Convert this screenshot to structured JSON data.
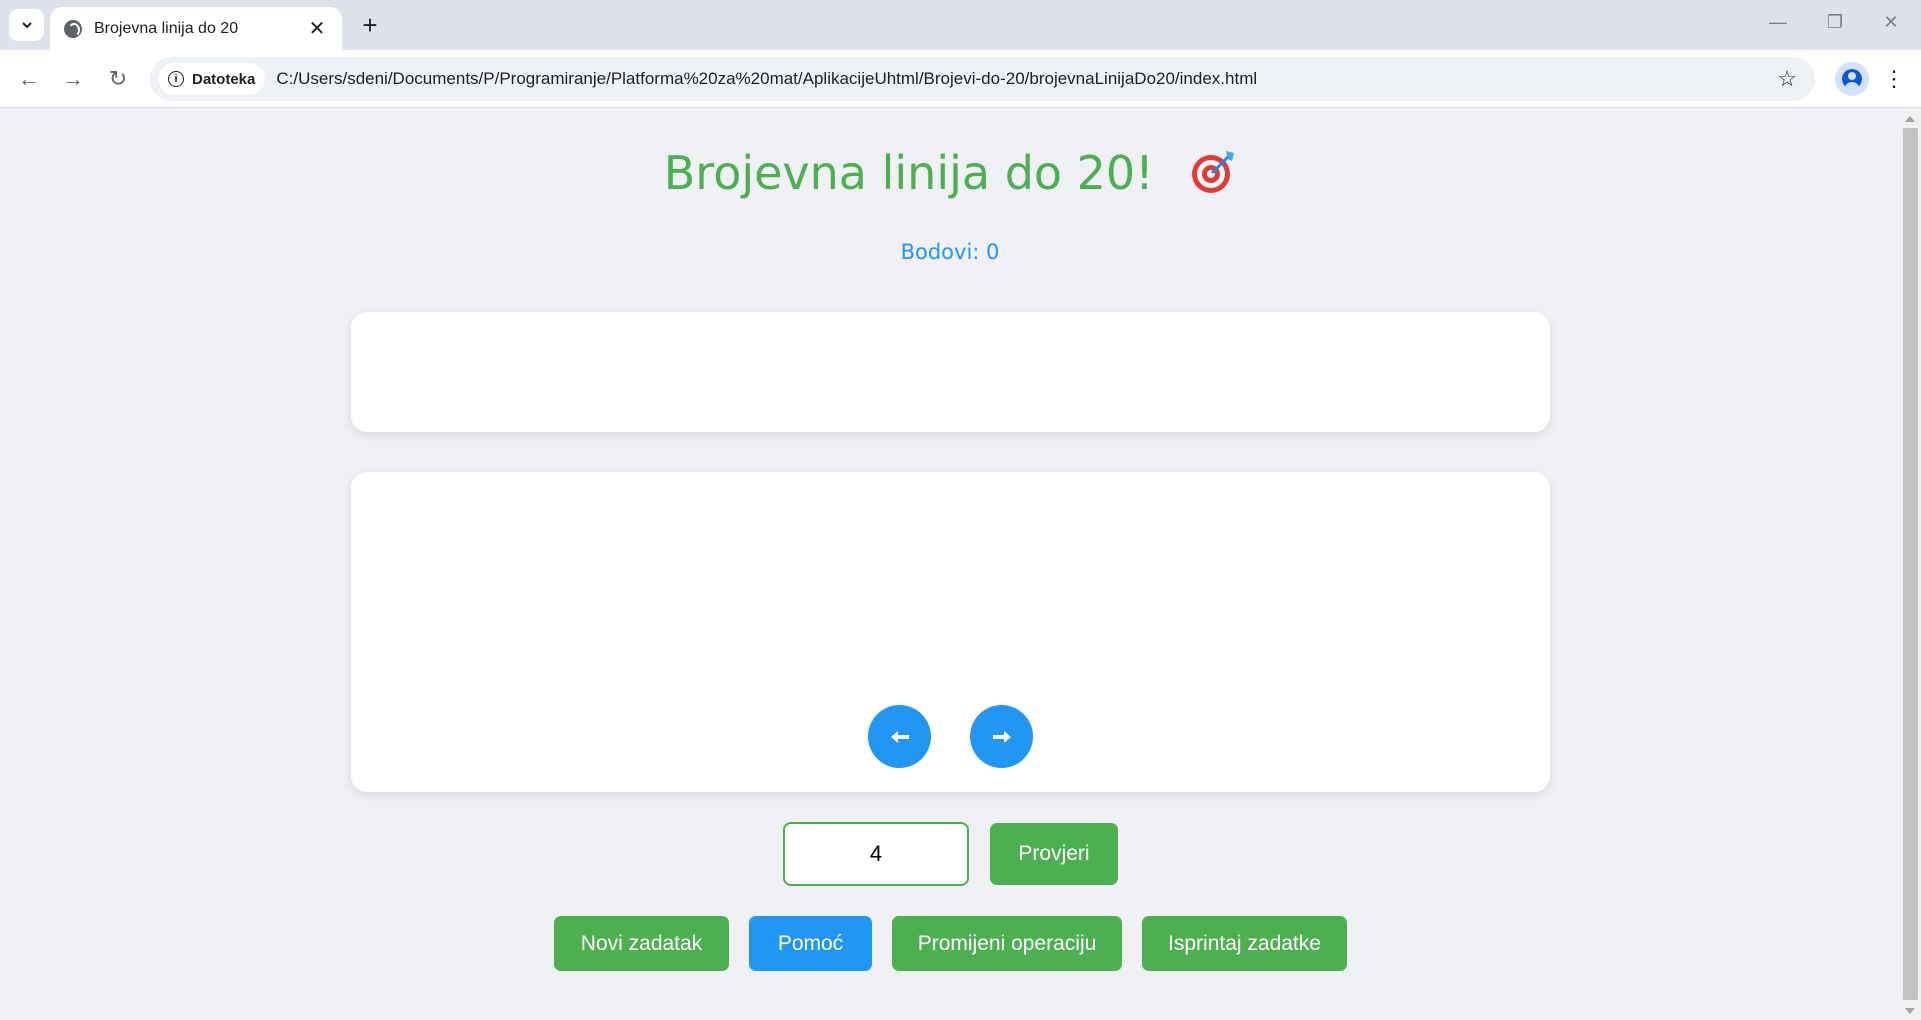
{
  "browser": {
    "tab_title": "Brojevna linija do 20",
    "security_chip": "Datoteka",
    "url": "C:/Users/sdeni/Documents/P/Programiranje/Platforma%20za%20mat/AplikacijeUhtml/Brojevi-do-20/brojevnaLinijaDo20/index.html"
  },
  "page": {
    "title": "Brojevna linija do 20!",
    "score_label": "Bodovi: 0",
    "answer_value": "4",
    "check_label": "Provjeri",
    "buttons": {
      "new_task": "Novi zadatak",
      "help": "Pomoć",
      "change_operation": "Promijeni operaciju",
      "print_tasks": "Isprintaj zadatke"
    }
  },
  "colors": {
    "green": "#4caf50",
    "blue": "#2196f3"
  }
}
